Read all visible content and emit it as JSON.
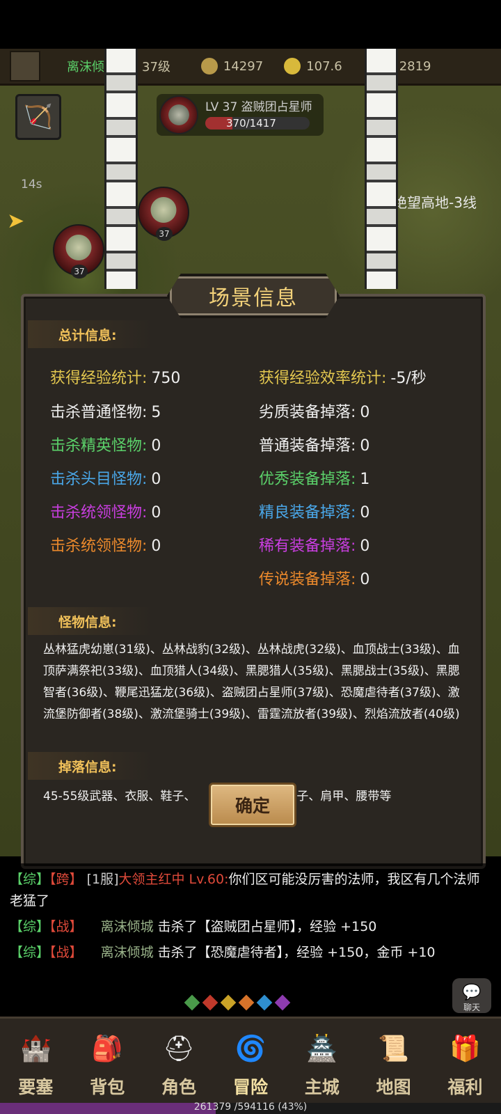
{
  "topbar": {
    "player_name": "离沫倾城",
    "level": "37级",
    "stat1": "14297",
    "stat2": "107.6",
    "diamonds": "2819"
  },
  "player_chip": {
    "title": "LV 37 盗贼团占星师",
    "hp": "370/1417"
  },
  "map": {
    "name": "绝望高地-3线",
    "timer": "14s"
  },
  "mobs": [
    {
      "level": "37"
    },
    {
      "level": "37"
    }
  ],
  "dialog": {
    "title": "场景信息",
    "total_header": "总计信息:",
    "stats_left": [
      {
        "label": "获得经验统计:",
        "value": "750",
        "color": "yellow"
      },
      {
        "label": "击杀普通怪物:",
        "value": "5",
        "color": "white"
      },
      {
        "label": "击杀精英怪物:",
        "value": "0",
        "color": "green"
      },
      {
        "label": "击杀头目怪物:",
        "value": "0",
        "color": "blue"
      },
      {
        "label": "击杀统领怪物:",
        "value": "0",
        "color": "purple"
      },
      {
        "label": "击杀统领怪物:",
        "value": "0",
        "color": "orange"
      }
    ],
    "stats_right": [
      {
        "label": "获得经验效率统计:",
        "value": "-5/秒",
        "color": "yellow"
      },
      {
        "label": "劣质装备掉落:",
        "value": "0",
        "color": "white"
      },
      {
        "label": "普通装备掉落:",
        "value": "0",
        "color": "white"
      },
      {
        "label": "优秀装备掉落:",
        "value": "1",
        "color": "green"
      },
      {
        "label": "精良装备掉落:",
        "value": "0",
        "color": "blue"
      },
      {
        "label": "稀有装备掉落:",
        "value": "0",
        "color": "purple"
      },
      {
        "label": "传说装备掉落:",
        "value": "0",
        "color": "orange"
      }
    ],
    "monster_header": "怪物信息:",
    "monster_text": "丛林猛虎幼崽(31级)、丛林战豹(32级)、丛林战虎(32级)、血顶战士(33级)、血顶萨满祭祀(33级)、血顶猎人(34级)、黑腮猎人(35级)、黑腮战士(35级)、黑腮智者(36级)、鞭尾迅猛龙(36级)、盗贼团占星师(37级)、恐魔虐待者(37级)、激流堡防御者(38级)、激流堡骑士(39级)、雷霆流放者(39级)、烈焰流放者(40级)",
    "drop_header": "掉落信息:",
    "drop_text": "45-55级武器、衣服、鞋子、",
    "drop_text_tail": "裤子、肩甲、腰带等",
    "ok_label": "确定"
  },
  "chat": {
    "lines": [
      {
        "tag1": "【综】",
        "tag2": "【跨】",
        "server": "[1服]",
        "name": "大领主红中 Lv.60:",
        "text": "你们区可能没厉害的法师，我区有几个法师老猛了"
      },
      {
        "tag1": "【综】",
        "tag2": "【战】",
        "name": "离沫倾城",
        "text": "击杀了【盗贼团占星师】，经验 +150"
      },
      {
        "tag1": "【综】",
        "tag2": "【战】",
        "name": "离沫倾城",
        "text": "击杀了【恐魔虐待者】，经验 +150，金币 +10"
      }
    ],
    "chat_button": "聊天"
  },
  "nav": [
    {
      "label": "要塞",
      "icon": "fortress-icon",
      "glyph": "🏰"
    },
    {
      "label": "背包",
      "icon": "backpack-icon",
      "glyph": "🎒"
    },
    {
      "label": "角色",
      "icon": "helmet-icon",
      "glyph": "⛑"
    },
    {
      "label": "冒险",
      "icon": "portal-icon",
      "glyph": "🌀"
    },
    {
      "label": "主城",
      "icon": "castle-icon",
      "glyph": "🏯"
    },
    {
      "label": "地图",
      "icon": "scroll-map-icon",
      "glyph": "📜"
    },
    {
      "label": "福利",
      "icon": "gift-icon",
      "glyph": "🎁"
    }
  ],
  "xp": {
    "text": "261379 /594116 (43%)",
    "fraction": 0.43
  },
  "colors": {
    "yellow": "#e4c84f",
    "white": "#f0f0f0",
    "green": "#5bd16a",
    "blue": "#4aa8ea",
    "purple": "#c93ee0",
    "orange": "#ec8a2c"
  }
}
